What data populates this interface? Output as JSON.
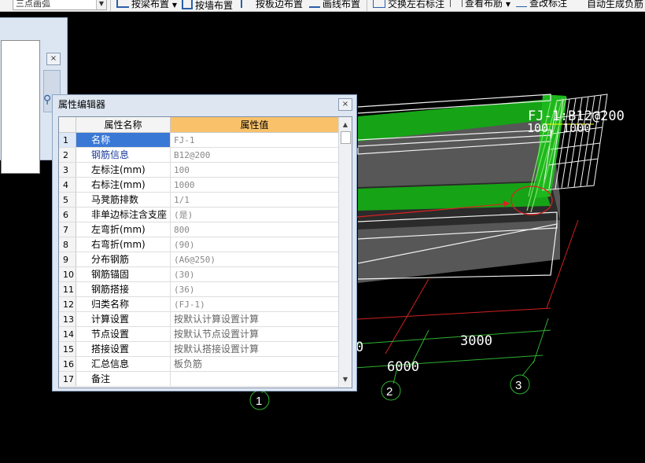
{
  "toolbar": {
    "combo_value": "三点画弧",
    "items": [
      "按梁布置",
      "按墙布置",
      "按板边布置",
      "画线布置",
      "交换左右标注",
      "查看布筋",
      "查改标注",
      "自动生成负筋"
    ]
  },
  "editor": {
    "title": "属性编辑器",
    "col_name": "属性名称",
    "col_value": "属性值",
    "rows": [
      {
        "n": "1",
        "k": "名称",
        "v": "FJ-1"
      },
      {
        "n": "2",
        "k": "钢筋信息",
        "v": "B12@200"
      },
      {
        "n": "3",
        "k": "左标注(mm)",
        "v": "100"
      },
      {
        "n": "4",
        "k": "右标注(mm)",
        "v": "1000"
      },
      {
        "n": "5",
        "k": "马凳筋排数",
        "v": "1/1"
      },
      {
        "n": "6",
        "k": "非单边标注含支座",
        "v": "(是)"
      },
      {
        "n": "7",
        "k": "左弯折(mm)",
        "v": "800"
      },
      {
        "n": "8",
        "k": "右弯折(mm)",
        "v": "(90)"
      },
      {
        "n": "9",
        "k": "分布钢筋",
        "v": "(A6@250)"
      },
      {
        "n": "10",
        "k": "钢筋锚固",
        "v": "(30)"
      },
      {
        "n": "11",
        "k": "钢筋搭接",
        "v": "(36)"
      },
      {
        "n": "12",
        "k": "归类名称",
        "v": "(FJ-1)"
      },
      {
        "n": "13",
        "k": "计算设置",
        "v": "按默认计算设置计算"
      },
      {
        "n": "14",
        "k": "节点设置",
        "v": "按默认节点设置计算"
      },
      {
        "n": "15",
        "k": "搭接设置",
        "v": "按默认搭接设置计算"
      },
      {
        "n": "16",
        "k": "汇总信息",
        "v": "板负筋"
      },
      {
        "n": "17",
        "k": "备注",
        "v": ""
      }
    ]
  },
  "canvas": {
    "rebar_label": "FJ-1:B12@200",
    "rebar_dims": "100, 1000",
    "dim_3000": "3000",
    "dim_6000": "6000",
    "dim_partial": "0",
    "axis_1": "1",
    "axis_2": "2",
    "axis_3": "3"
  },
  "colors": {
    "slab_green": "#16a316",
    "rebar_green": "#7fe26a",
    "highlight": "#3a78d6",
    "header": "#f9c26a"
  }
}
